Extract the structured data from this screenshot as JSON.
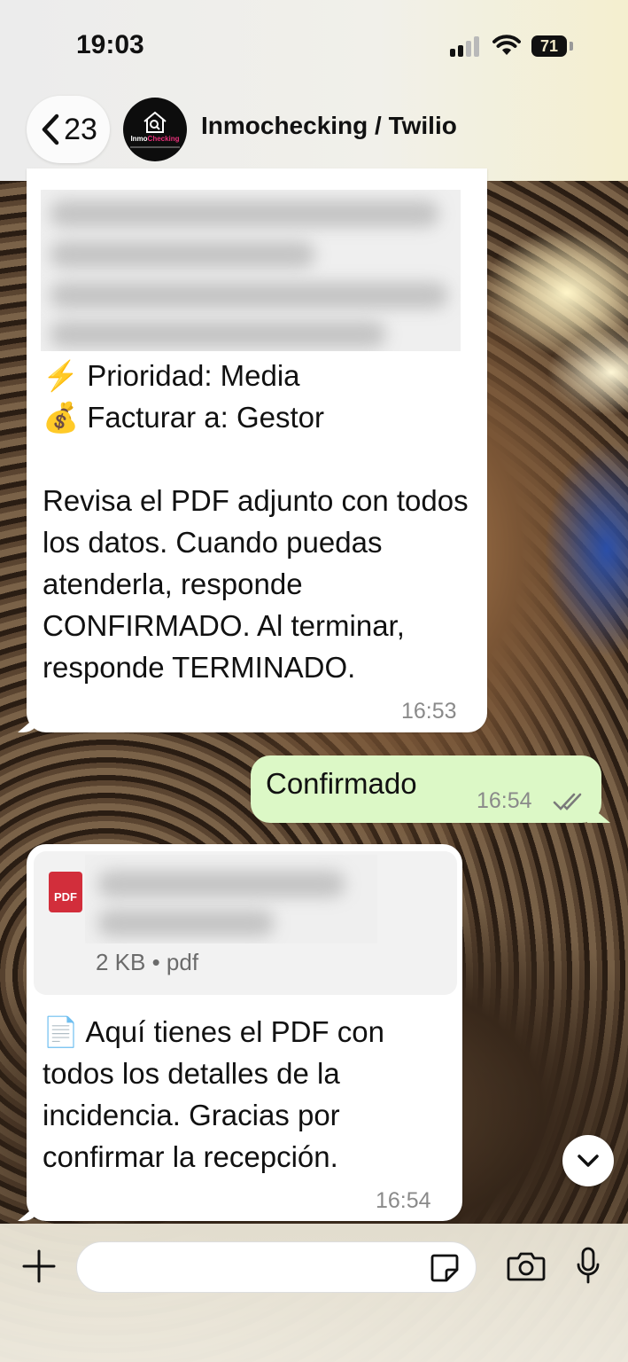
{
  "status_bar": {
    "time": "19:03",
    "battery": "71"
  },
  "header": {
    "back_count": "23",
    "title": "Inmochecking / Twilio",
    "avatar": {
      "brand_prefix": "Inmo",
      "brand_suffix": "Checking"
    }
  },
  "messages": [
    {
      "direction": "incoming",
      "lines": [
        "⚡ Prioridad: Media",
        "💰 Facturar a: Gestor"
      ],
      "paragraph": "Revisa el PDF adjunto con todos los datos. Cuando puedas atenderla, responde CONFIRMADO. Al terminar, responde TERMINADO.",
      "time": "16:53"
    },
    {
      "direction": "outgoing",
      "text": "Confirmado",
      "time": "16:54",
      "status": "read"
    },
    {
      "direction": "incoming",
      "attachment": {
        "icon_label": "PDF",
        "meta": "2 KB • pdf"
      },
      "text": "📄 Aquí tienes el PDF con todos los detalles de la incidencia. Gracias por confirmar la recepción.",
      "time": "16:54"
    }
  ],
  "composer": {
    "placeholder": ""
  },
  "icons": {
    "back": "chevron-left-icon",
    "plus": "plus-icon",
    "sticker": "sticker-icon",
    "camera": "camera-icon",
    "mic": "microphone-icon",
    "scroll_down": "chevron-down-icon",
    "read_receipt": "double-check-icon"
  },
  "colors": {
    "outgoing_bubble": "#dcf8c6",
    "incoming_bubble": "#ffffff",
    "pdf_red": "#d22e3b",
    "avatar_accent": "#e8307a"
  }
}
